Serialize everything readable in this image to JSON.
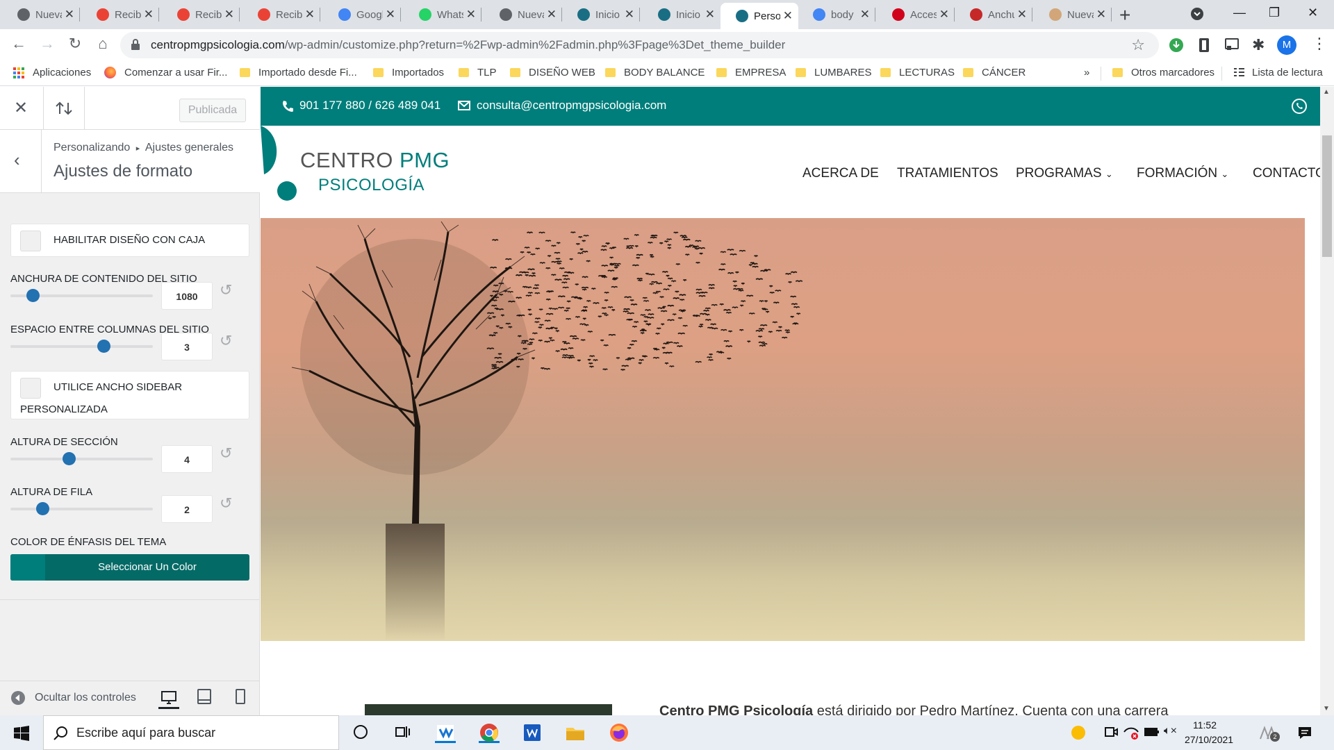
{
  "browser": {
    "tabs": [
      {
        "title": "Nueva",
        "icon": "chrome-icon",
        "color": "#5f6368"
      },
      {
        "title": "Recibidos",
        "icon": "gmail-icon",
        "color": "#ea4335"
      },
      {
        "title": "Recibidos",
        "icon": "gmail-icon",
        "color": "#ea4335"
      },
      {
        "title": "Recibidos",
        "icon": "gmail-icon",
        "color": "#ea4335"
      },
      {
        "title": "Google",
        "icon": "calendar-icon",
        "color": "#4285f4"
      },
      {
        "title": "WhatsApp",
        "icon": "whatsapp-icon",
        "color": "#25d366"
      },
      {
        "title": "Nueva",
        "icon": "chrome-icon",
        "color": "#5f6368"
      },
      {
        "title": "Inicio",
        "icon": "divi-icon",
        "color": "#1a6e84"
      },
      {
        "title": "Inicio",
        "icon": "divi-icon",
        "color": "#1a6e84"
      },
      {
        "title": "Personalizando",
        "icon": "divi-icon",
        "color": "#1a6e84"
      },
      {
        "title": "body",
        "icon": "google-icon",
        "color": "#4285f4"
      },
      {
        "title": "Acceso",
        "icon": "wix-icon",
        "color": "#d0021b"
      },
      {
        "title": "Anchura",
        "icon": "office-icon",
        "color": "#c62828"
      },
      {
        "title": "Nueva",
        "icon": "bird-icon",
        "color": "#d2a679"
      }
    ],
    "active_tab_index": 9,
    "url_domain": "centropmgpsicologia.com",
    "url_path": "/wp-admin/customize.php?return=%2Fwp-admin%2Fadmin.php%3Fpage%3Det_theme_builder",
    "profile_initial": "M",
    "bookmarks": [
      {
        "label": "Aplicaciones",
        "icon": "apps-icon"
      },
      {
        "label": "Comenzar a usar Fir...",
        "icon": "firefox-icon"
      },
      {
        "label": "Importado desde Fi...",
        "icon": "folder-icon"
      },
      {
        "label": "Importados",
        "icon": "folder-icon"
      },
      {
        "label": "TLP",
        "icon": "folder-icon"
      },
      {
        "label": "DISEÑO WEB",
        "icon": "folder-icon"
      },
      {
        "label": "BODY BALANCE",
        "icon": "folder-icon"
      },
      {
        "label": "EMPRESA",
        "icon": "folder-icon"
      },
      {
        "label": "LUMBARES",
        "icon": "folder-icon"
      },
      {
        "label": "LECTURAS",
        "icon": "folder-icon"
      },
      {
        "label": "CÁNCER",
        "icon": "folder-icon"
      }
    ],
    "more_bookmarks": "»",
    "other_bookmarks": "Otros marcadores",
    "reading_list": "Lista de lectura"
  },
  "customizer": {
    "publish_label": "Publicada",
    "breadcrumb_root": "Personalizando",
    "breadcrumb_section": "Ajustes generales",
    "panel_title": "Ajustes de formato",
    "boxed_label": "HABILITAR DISEÑO CON CAJA",
    "content_width": {
      "label": "ANCHURA DE CONTENIDO DEL SITIO WEB",
      "value": "1080"
    },
    "gutter": {
      "label": "ESPACIO ENTRE COLUMNAS DEL SITIO WEB",
      "value": "3"
    },
    "sidebar_label_1": "UTILICE ANCHO SIDEBAR",
    "sidebar_label_2": "PERSONALIZADA",
    "section_height": {
      "label": "ALTURA DE SECCIÓN",
      "value": "4"
    },
    "row_height": {
      "label": "ALTURA DE FILA",
      "value": "2"
    },
    "accent_label": "COLOR DE ÉNFASIS DEL TEMA",
    "color_button": "Seleccionar Un Color",
    "accent_color": "#007e7b",
    "hide_controls": "Ocultar los controles"
  },
  "site": {
    "phone": "901 177 880 / 626 489 041",
    "email": "consulta@centropmgpsicologia.com",
    "logo_line1a": "CENTRO ",
    "logo_line1b": "PMG",
    "logo_line2": "PSICOLOGÍA",
    "menu": [
      "ACERCA DE",
      "TRATAMIENTOS",
      "PROGRAMAS",
      "FORMACIÓN",
      "CONTACTO"
    ],
    "intro_bold": "Centro PMG Psicología",
    "intro_rest": " está dirigido por Pedro Martínez. Cuenta con una carrera",
    "brand_color": "#007e7b"
  },
  "taskbar": {
    "search_placeholder": "Escribe aquí para buscar",
    "time": "11:52",
    "date": "27/10/2021",
    "notif_count": "2"
  }
}
